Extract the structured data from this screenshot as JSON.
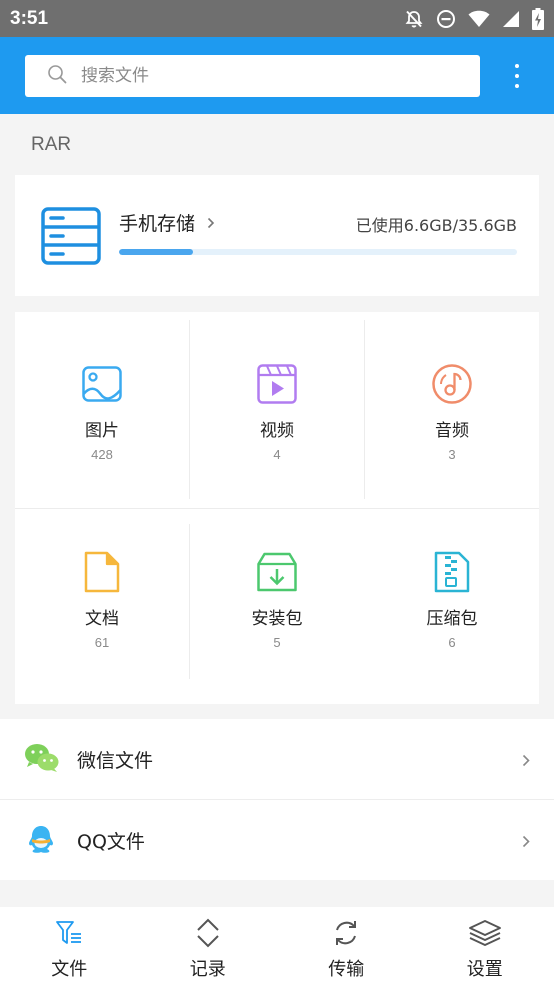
{
  "status_bar": {
    "time": "3:51",
    "icons": [
      "notifications-off-icon",
      "do-not-disturb-icon",
      "wifi-icon",
      "signal-icon",
      "battery-charging-icon"
    ]
  },
  "search": {
    "placeholder": "搜索文件",
    "value": ""
  },
  "header": {
    "more_icon": "more-vert-icon",
    "accent_color": "#1e9af0"
  },
  "section_title": "RAR",
  "storage": {
    "name": "手机存储",
    "usage_text": "已使用6.6GB/35.6GB",
    "used_fraction": 0.185
  },
  "categories": [
    {
      "label": "图片",
      "count": "428",
      "icon": "image-icon",
      "color": "#3aaaf0"
    },
    {
      "label": "视频",
      "count": "4",
      "icon": "video-icon",
      "color": "#b17cf0"
    },
    {
      "label": "音频",
      "count": "3",
      "icon": "music-icon",
      "color": "#f08c6a"
    },
    {
      "label": "文档",
      "count": "61",
      "icon": "document-icon",
      "color": "#f6b73c"
    },
    {
      "label": "安装包",
      "count": "5",
      "icon": "package-icon",
      "color": "#4cc86e"
    },
    {
      "label": "压缩包",
      "count": "6",
      "icon": "zip-icon",
      "color": "#2ab4d4"
    }
  ],
  "apps": [
    {
      "label": "微信文件",
      "icon": "wechat-icon"
    },
    {
      "label": "QQ文件",
      "icon": "qq-icon"
    }
  ],
  "bottom_nav": [
    {
      "label": "文件",
      "icon": "files-icon",
      "active": true
    },
    {
      "label": "记录",
      "icon": "history-icon",
      "active": false
    },
    {
      "label": "传输",
      "icon": "transfer-icon",
      "active": false
    },
    {
      "label": "设置",
      "icon": "settings-icon",
      "active": false
    }
  ]
}
